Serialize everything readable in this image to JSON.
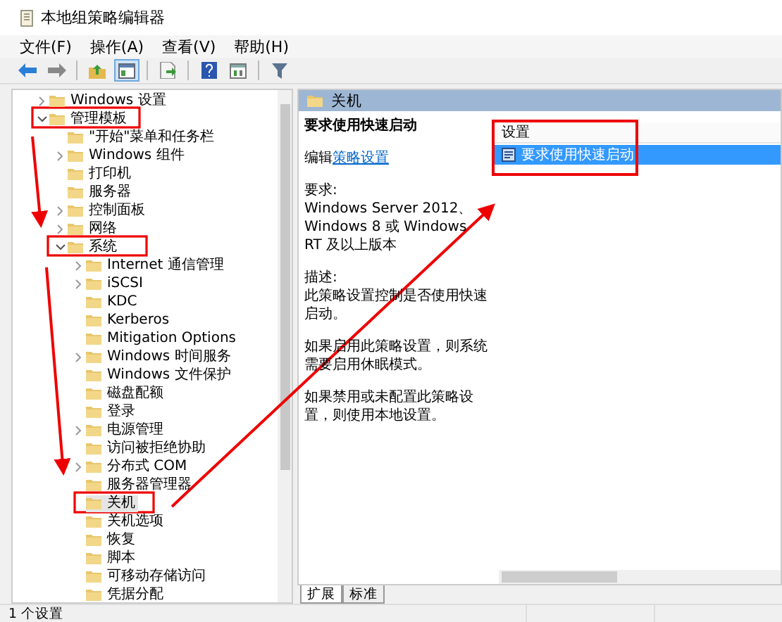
{
  "window": {
    "title": "本地组策略编辑器"
  },
  "menu": [
    "文件(F)",
    "操作(A)",
    "查看(V)",
    "帮助(H)"
  ],
  "toolbar": [
    {
      "kind": "back",
      "pressed": false
    },
    {
      "kind": "forward",
      "pressed": false
    },
    {
      "kind": "sep"
    },
    {
      "kind": "up",
      "pressed": false
    },
    {
      "kind": "tree",
      "pressed": true
    },
    {
      "kind": "sep"
    },
    {
      "kind": "export",
      "pressed": false
    },
    {
      "kind": "sep"
    },
    {
      "kind": "help",
      "pressed": false
    },
    {
      "kind": "view",
      "pressed": false
    },
    {
      "kind": "sep"
    },
    {
      "kind": "filter",
      "pressed": false
    }
  ],
  "tree": [
    {
      "label": "Windows 设置",
      "kind": "branch",
      "expanded": false,
      "selected": false
    },
    {
      "label": "管理模板",
      "kind": "branch",
      "expanded": true,
      "selected": false,
      "children": [
        {
          "label": "\"开始\"菜单和任务栏",
          "kind": "leaf",
          "selected": false
        },
        {
          "label": "Windows 组件",
          "kind": "branch",
          "expanded": false,
          "selected": false
        },
        {
          "label": "打印机",
          "kind": "leaf",
          "selected": false
        },
        {
          "label": "服务器",
          "kind": "leaf",
          "selected": false
        },
        {
          "label": "控制面板",
          "kind": "branch",
          "expanded": false,
          "selected": false
        },
        {
          "label": "网络",
          "kind": "branch",
          "expanded": false,
          "selected": false
        },
        {
          "label": "系统",
          "kind": "branch",
          "expanded": true,
          "selected": false,
          "children": [
            {
              "label": "Internet 通信管理",
              "kind": "branch",
              "expanded": false,
              "selected": false
            },
            {
              "label": "iSCSI",
              "kind": "branch",
              "expanded": false,
              "selected": false
            },
            {
              "label": "KDC",
              "kind": "leaf",
              "selected": false
            },
            {
              "label": "Kerberos",
              "kind": "leaf",
              "selected": false
            },
            {
              "label": "Mitigation Options",
              "kind": "leaf",
              "selected": false
            },
            {
              "label": "Windows 时间服务",
              "kind": "branch",
              "expanded": false,
              "selected": false
            },
            {
              "label": "Windows 文件保护",
              "kind": "leaf",
              "selected": false
            },
            {
              "label": "磁盘配额",
              "kind": "leaf",
              "selected": false
            },
            {
              "label": "登录",
              "kind": "leaf",
              "selected": false
            },
            {
              "label": "电源管理",
              "kind": "branch",
              "expanded": false,
              "selected": false
            },
            {
              "label": "访问被拒绝协助",
              "kind": "leaf",
              "selected": false
            },
            {
              "label": "分布式 COM",
              "kind": "branch",
              "expanded": false,
              "selected": false
            },
            {
              "label": "服务器管理器",
              "kind": "leaf",
              "selected": false
            },
            {
              "label": "关机",
              "kind": "leaf",
              "selected": true
            },
            {
              "label": "关机选项",
              "kind": "leaf",
              "selected": false
            },
            {
              "label": "恢复",
              "kind": "leaf",
              "selected": false
            },
            {
              "label": "脚本",
              "kind": "leaf",
              "selected": false
            },
            {
              "label": "可移动存储访问",
              "kind": "leaf",
              "selected": false
            },
            {
              "label": "凭据分配",
              "kind": "leaf",
              "selected": false
            }
          ]
        }
      ]
    }
  ],
  "detail": {
    "header": "关机",
    "policy_title": "要求使用快速启动",
    "edit_prefix": "编辑",
    "edit_link": "策略设置",
    "paragraphs": [
      {
        "kind": "label",
        "text": "要求:"
      },
      {
        "kind": "text",
        "text": "Windows Server 2012、Windows 8 或 Windows RT 及以上版本"
      },
      {
        "kind": "label",
        "text": "描述:"
      },
      {
        "kind": "text",
        "text": "此策略设置控制是否使用快速启动。"
      },
      {
        "kind": "text",
        "text": "如果启用此策略设置，则系统需要启用休眠模式。"
      },
      {
        "kind": "text",
        "text": "如果禁用或未配置此策略设置，则使用本地设置。"
      }
    ]
  },
  "settings": {
    "column": "设置",
    "rows": [
      {
        "label": "要求使用快速启动",
        "selected": true
      }
    ]
  },
  "tabs": [
    {
      "label": "扩展",
      "selected": true
    },
    {
      "label": "标准",
      "selected": false
    }
  ],
  "status_bar": "1 个设置"
}
